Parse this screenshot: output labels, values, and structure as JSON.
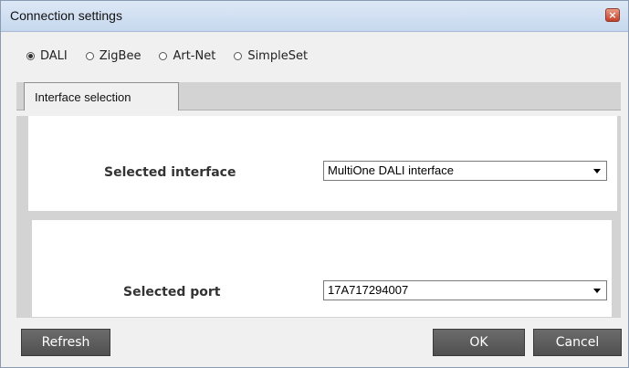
{
  "window": {
    "title": "Connection settings"
  },
  "protocols": [
    {
      "label": "DALI",
      "checked": true
    },
    {
      "label": "ZigBee",
      "checked": false
    },
    {
      "label": "Art-Net",
      "checked": false
    },
    {
      "label": "SimpleSet",
      "checked": false
    }
  ],
  "tabs": [
    {
      "label": "Interface selection"
    }
  ],
  "interface": {
    "label": "Selected interface",
    "value": "MultiOne DALI interface"
  },
  "port": {
    "label": "Selected port",
    "value": "17A717294007"
  },
  "buttons": {
    "refresh": "Refresh",
    "ok": "OK",
    "cancel": "Cancel"
  }
}
